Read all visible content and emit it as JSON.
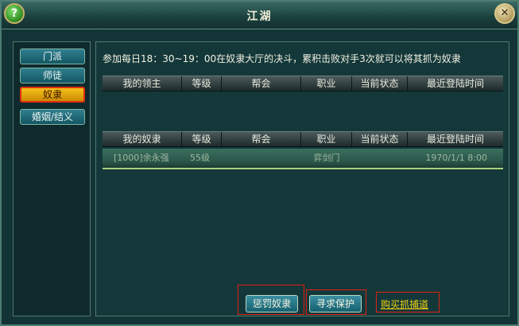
{
  "window": {
    "title": "江湖",
    "help_glyph": "?",
    "close_glyph": "✕"
  },
  "sidebar": {
    "items": [
      {
        "label": "门派"
      },
      {
        "label": "师徒"
      },
      {
        "label": "奴隶",
        "active": true
      },
      {
        "label": "婚姻/结义"
      }
    ]
  },
  "main": {
    "info_text": "参加每日18：30~19：00在奴隶大厅的决斗，累积击败对手3次就可以将其抓为奴隶",
    "master_table": {
      "columns": [
        "我的领主",
        "等级",
        "帮会",
        "职业",
        "当前状态",
        "最近登陆时间"
      ],
      "rows": []
    },
    "slave_table": {
      "columns": [
        "我的奴隶",
        "等级",
        "帮会",
        "职业",
        "当前状态",
        "最近登陆时间"
      ],
      "rows": [
        {
          "name": "[1000]余永强",
          "level": "55级",
          "guild": "",
          "job": "弈剑门",
          "status": "",
          "last_login": "1970/1/1 8:00"
        }
      ]
    },
    "buttons": {
      "punish": "惩罚奴隶",
      "protect": "寻求保护",
      "buy": "购买抓捕道"
    }
  },
  "colors": {
    "active_tab": "#f6c21a",
    "highlight_border": "#e02010",
    "link": "#f0d010"
  }
}
